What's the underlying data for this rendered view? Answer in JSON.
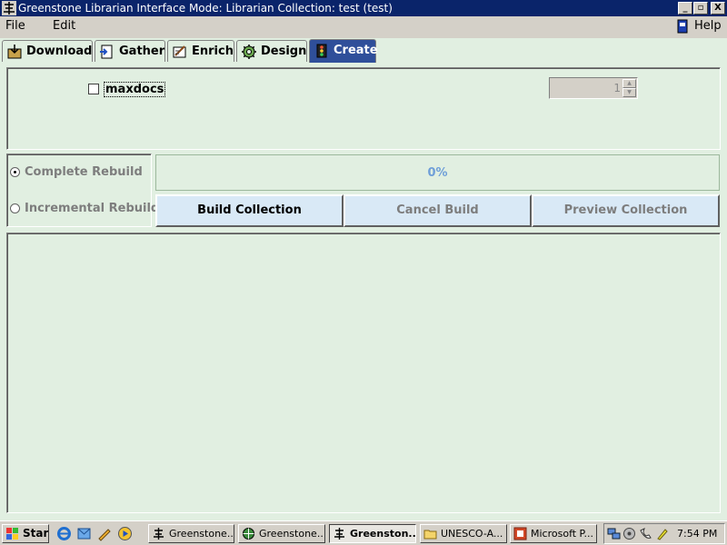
{
  "window": {
    "title": "Greenstone Librarian Interface  Mode: Librarian  Collection: test (test)",
    "buttons": [
      "_",
      "▫",
      "X"
    ]
  },
  "menu": {
    "items": [
      "File",
      "Edit"
    ],
    "help": "Help"
  },
  "tabs": [
    {
      "label": "Download",
      "icon": "download-icon"
    },
    {
      "label": "Gather",
      "icon": "gather-icon"
    },
    {
      "label": "Enrich",
      "icon": "enrich-icon"
    },
    {
      "label": "Design",
      "icon": "design-icon"
    },
    {
      "label": "Create",
      "icon": "create-icon",
      "active": true
    }
  ],
  "options": {
    "maxdocs_label": "maxdocs",
    "maxdocs_checked": false,
    "maxdocs_value": "1"
  },
  "rebuild": {
    "complete": "Complete Rebuild",
    "incremental": "Incremental Rebuild",
    "selected": "complete"
  },
  "progress": {
    "text": "0%",
    "value": 0
  },
  "actions": {
    "build": "Build Collection",
    "cancel": "Cancel Build",
    "preview": "Preview Collection"
  },
  "taskbar": {
    "start": "Start",
    "tasks": [
      {
        "label": "Greenstone...",
        "icon": "greenstone-icon"
      },
      {
        "label": "Greenstone...",
        "icon": "globe-icon"
      },
      {
        "label": "Greenston...",
        "icon": "greenstone-icon",
        "active": true
      },
      {
        "label": "UNESCO-A...",
        "icon": "folder-icon"
      },
      {
        "label": "Microsoft P...",
        "icon": "powerpoint-icon"
      }
    ],
    "clock": "7:54 PM"
  },
  "colors": {
    "title_bar": "#0a246a",
    "panel_bg": "#e1efe1",
    "active_tab": "#2f4f9a",
    "button_bg": "#d9e9f6",
    "progress_text": "#6f9fd8"
  }
}
